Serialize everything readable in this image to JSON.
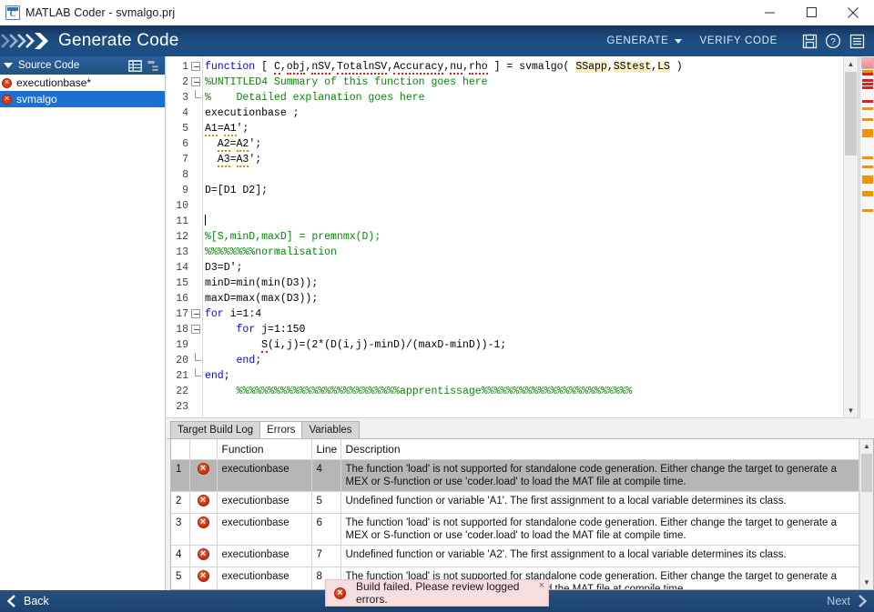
{
  "window": {
    "title": "MATLAB Coder - svmalgo.prj",
    "app_icon": "matlab-coder-icon",
    "minimize_label": "Minimize",
    "maximize_label": "Maximize",
    "close_label": "Close"
  },
  "header": {
    "title": "Generate Code",
    "generate_label": "GENERATE",
    "verify_label": "VERIFY CODE",
    "save_icon": "save-icon",
    "help_icon": "help-icon",
    "menu_icon": "menu-icon"
  },
  "sidebar": {
    "title": "Source Code",
    "view_icon_1": "list-view-icon",
    "view_icon_2": "tree-view-icon",
    "items": [
      {
        "label": "executionbase*",
        "status": "error",
        "selected": false
      },
      {
        "label": "svmalgo",
        "status": "error",
        "selected": true
      }
    ]
  },
  "editor": {
    "lines": [
      {
        "n": "1",
        "fold": "open",
        "html": "<span class=\"kw\">function</span> [ <span class=\"wavr\">C</span>,<span class=\"wavr\">obj</span>,<span class=\"wavr\">nSV</span>,<span class=\"wavr\">TotalnSV</span>,<span class=\"wavr\">Accuracy</span>,<span class=\"wavr\">nu</span>,<span class=\"wavr\">rho</span> ] = svmalgo( <span class=\"hl\">SSapp</span>,<span class=\"hl\">SStest</span>,<span class=\"hl\">LS</span> )"
      },
      {
        "n": "2",
        "fold": "open",
        "html": "<span class=\"cm\">%UNTITLED4 Summary of this function goes here</span>"
      },
      {
        "n": "3",
        "fold": "end",
        "html": "<span class=\"cm\">%    Detailed explanation goes here</span>"
      },
      {
        "n": "4",
        "fold": "",
        "html": "executionbase ;"
      },
      {
        "n": "5",
        "fold": "",
        "html": "<span class=\"wav\">A1</span>=<span class=\"wav\">A1</span>';"
      },
      {
        "n": "6",
        "fold": "",
        "html": "  <span class=\"wav\">A2</span>=<span class=\"wav\">A2</span>';"
      },
      {
        "n": "7",
        "fold": "",
        "html": "  <span class=\"wav\">A3</span>=<span class=\"wav\">A3</span>';"
      },
      {
        "n": "8",
        "fold": "",
        "html": ""
      },
      {
        "n": "9",
        "fold": "",
        "html": "D=[D1 D2];"
      },
      {
        "n": "10",
        "fold": "",
        "html": ""
      },
      {
        "n": "11",
        "fold": "",
        "html": "<span class=\"caret-line\"></span>"
      },
      {
        "n": "12",
        "fold": "",
        "html": "<span class=\"cm\">%[S,minD,maxD] = premnmx(D);</span>"
      },
      {
        "n": "13",
        "fold": "",
        "html": "<span class=\"cm\">%%%%%%%%normalisation</span>"
      },
      {
        "n": "14",
        "fold": "",
        "html": "D3=D';"
      },
      {
        "n": "15",
        "fold": "",
        "html": "minD=min(min(D3));"
      },
      {
        "n": "16",
        "fold": "",
        "html": "maxD=max(max(D3));"
      },
      {
        "n": "17",
        "fold": "open",
        "html": "<span class=\"kw\">for</span> i=1:4"
      },
      {
        "n": "18",
        "fold": "open",
        "html": "     <span class=\"kw\">for</span> j=1:150"
      },
      {
        "n": "19",
        "fold": "",
        "html": "         <span class=\"wavr\">S</span>(i,j)=(2*(D(i,j)-minD)/(maxD-minD))-1;"
      },
      {
        "n": "20",
        "fold": "end",
        "html": "     <span class=\"kw\">end</span>;"
      },
      {
        "n": "21",
        "fold": "end",
        "html": "<span class=\"kw\">end</span>;"
      },
      {
        "n": "22",
        "fold": "",
        "html": "     <span class=\"cm\">%%%%%%%%%%%%%%%%%%%%%%%%%%apprentissage%%%%%%%%%%%%%%%%%%%%%%%%</span>"
      },
      {
        "n": "23",
        "fold": "",
        "html": ""
      }
    ]
  },
  "markers": {
    "red": [
      18,
      25,
      29,
      33,
      48
    ],
    "orange": [
      15,
      56,
      68,
      80,
      83,
      86,
      110,
      120,
      131,
      134,
      137,
      148,
      151,
      168
    ]
  },
  "bottom_panel": {
    "tabs": [
      {
        "label": "Target Build Log",
        "active": false
      },
      {
        "label": "Errors",
        "active": true
      },
      {
        "label": "Variables",
        "active": false
      }
    ],
    "columns": [
      "",
      "",
      "Function",
      "Line",
      "Description"
    ],
    "rows": [
      {
        "num": "1",
        "icon": "error-icon",
        "function": "executionbase",
        "line": "4",
        "description": "The function 'load' is not supported for standalone code generation. Either change the target to generate a MEX or S-function or use 'coder.load' to load the MAT file at compile time.",
        "selected": true
      },
      {
        "num": "2",
        "icon": "error-icon",
        "function": "executionbase",
        "line": "5",
        "description": "Undefined function or variable 'A1'. The first assignment to a local variable determines its class.",
        "selected": false
      },
      {
        "num": "3",
        "icon": "error-icon",
        "function": "executionbase",
        "line": "6",
        "description": "The function 'load' is not supported for standalone code generation. Either change the target to generate a MEX or S-function or use 'coder.load' to load the MAT file at compile time.",
        "selected": false
      },
      {
        "num": "4",
        "icon": "error-icon",
        "function": "executionbase",
        "line": "7",
        "description": "Undefined function or variable 'A2'. The first assignment to a local variable determines its class.",
        "selected": false
      },
      {
        "num": "5",
        "icon": "error-icon",
        "function": "executionbase",
        "line": "8",
        "description": "The function 'load' is not supported for standalone code generation. Either change the target to generate a MEX or S-function or use 'coder.load' to load the MAT file at compile time.",
        "selected": false
      }
    ]
  },
  "toast": {
    "message": "Build failed. Please review logged errors.",
    "icon": "error-icon",
    "close_label": "×"
  },
  "navbar": {
    "back_label": "Back",
    "next_label": "Next",
    "back_icon": "chevron-left-icon",
    "next_icon": "chevron-right-icon"
  },
  "colors": {
    "header_blue": "#1d4c80",
    "select_blue": "#1d6fd0",
    "error_red": "#cf2a12",
    "comment_green": "#028a02",
    "keyword_blue": "#0000ff",
    "highlight_yellow": "#fbf1c7"
  }
}
